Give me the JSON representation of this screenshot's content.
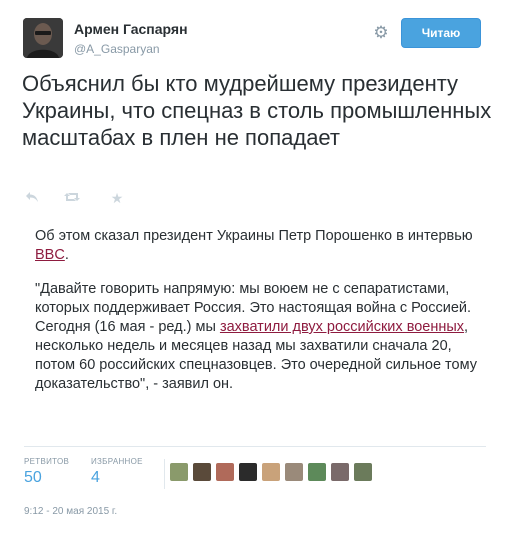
{
  "author": {
    "name": "Армен Гаспарян",
    "handle": "@A_Gasparyan"
  },
  "follow_button": {
    "label": "Читаю"
  },
  "tweet": {
    "text": "Объяснил бы кто мудрейшему президенту Украины, что спецназ в столь промышленных масштабах в плен не попадает"
  },
  "actions": [
    {
      "icon": "reply-icon"
    },
    {
      "icon": "retweet-icon"
    },
    {
      "icon": "favorite-star-icon"
    }
  ],
  "quote": {
    "p1_before": "Об этом сказал президент Украины Петр Порошенко в интервью ",
    "p1_link": "BBC",
    "p1_after": ".",
    "p2_before": "\"Давайте говорить напрямую: мы воюем не с сепаратистами, которых поддерживает Россия. Это настоящая война с Россией. Сегодня (16 мая - ред.) мы ",
    "p2_link": "захватили двух российских военных",
    "p2_after": ", несколько недель и месяцев назад мы захватили сначала 20, потом 60 российских спецназовцев. Это очередной сильное тому доказательство\", - заявил он."
  },
  "stats": {
    "retweets_label": "РЕТВИТОВ",
    "retweets_value": "50",
    "favorites_label": "ИЗБРАННОЕ",
    "favorites_value": "4"
  },
  "favoriters": [
    {
      "color": "#8a9a6b"
    },
    {
      "color": "#5a4a3a"
    },
    {
      "color": "#b06a5a"
    },
    {
      "color": "#2b2b2b"
    },
    {
      "color": "#c9a27a"
    },
    {
      "color": "#9a8a7a"
    },
    {
      "color": "#5d8a5a"
    },
    {
      "color": "#7a6a6a"
    },
    {
      "color": "#6b7b5b"
    }
  ],
  "timestamp": "9:12 - 20 мая 2015 г.",
  "colors": {
    "accent": "#4aa3df",
    "link": "#8e1b3f",
    "muted": "#8899a6"
  }
}
